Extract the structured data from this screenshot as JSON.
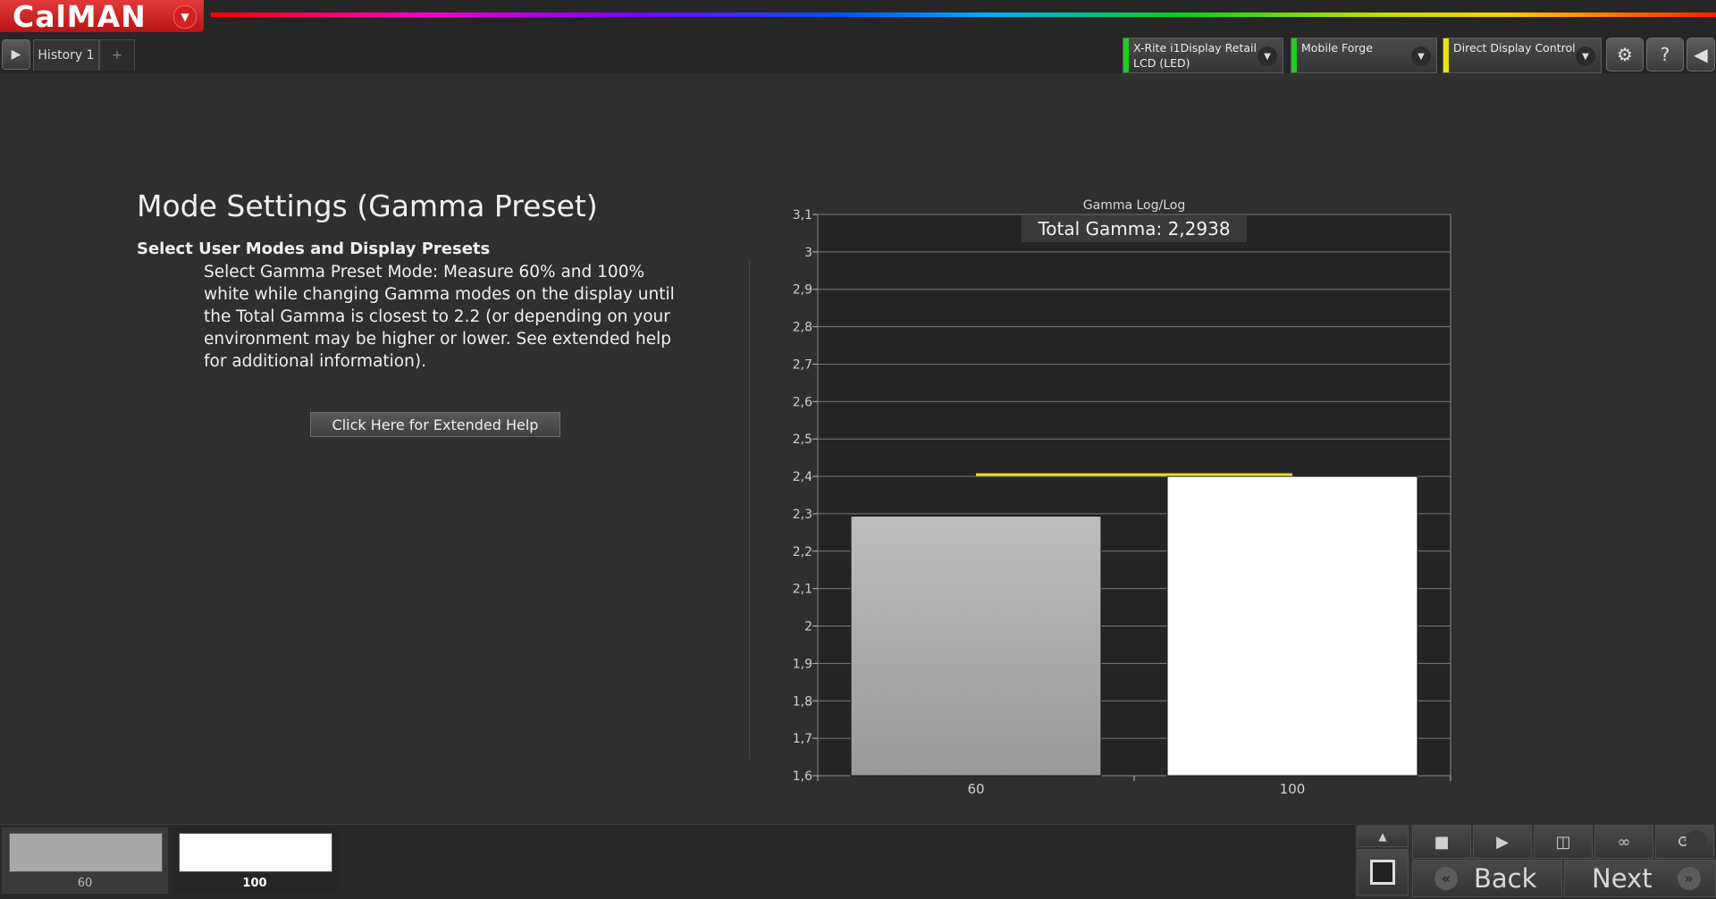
{
  "app": {
    "logo": "CalMAN",
    "logo_menu_icon": "chevron-down-icon"
  },
  "tabs": {
    "history_label": "History 1",
    "add_label": "+"
  },
  "devices": [
    {
      "line1": "X-Rite i1Display Retail",
      "line2": "LCD (LED)",
      "status_color": "#22cc22"
    },
    {
      "line1": "Mobile Forge",
      "line2": "",
      "status_color": "#22cc22"
    },
    {
      "line1": "Direct Display Control",
      "line2": "",
      "status_color": "#e6e600"
    }
  ],
  "toolbar_icons": [
    "gear-icon",
    "help-icon",
    "collapse-left-icon"
  ],
  "content": {
    "title": "Mode Settings (Gamma Preset)",
    "subtitle": "Select User Modes and Display Presets",
    "description": "Select Gamma Preset Mode: Measure 60% and 100% white while changing Gamma modes on the display until the Total Gamma is closest to 2.2 (or depending on your environment may be higher or lower. See extended help for additional information).",
    "help_button": "Click Here for Extended Help"
  },
  "chart_data": {
    "type": "bar",
    "title": "Gamma Log/Log",
    "annotation": "Total Gamma: 2,2938",
    "categories": [
      "60",
      "100"
    ],
    "values": [
      2.2938,
      2.4
    ],
    "bar_colors": [
      "#a8a8a8",
      "#ffffff"
    ],
    "target_line": {
      "value": 2.4,
      "color": "#e8e020"
    },
    "ylim": [
      1.6,
      3.1
    ],
    "yticks": [
      "1,6",
      "1,7",
      "1,8",
      "1,9",
      "2",
      "2,1",
      "2,2",
      "2,3",
      "2,4",
      "2,5",
      "2,6",
      "2,7",
      "2,8",
      "2,9",
      "3",
      "3,1"
    ],
    "grid": true,
    "xlabel": "",
    "ylabel": ""
  },
  "bottom": {
    "swatches": [
      {
        "label": "60",
        "color": "#a8a8a8"
      },
      {
        "label": "100",
        "color": "#ffffff"
      }
    ],
    "controls": [
      "eject-icon",
      "stop-icon",
      "play-icon",
      "read-continuous-icon",
      "loop-icon",
      "refresh-icon",
      "record-icon"
    ],
    "back_label": "Back",
    "next_label": "Next"
  }
}
